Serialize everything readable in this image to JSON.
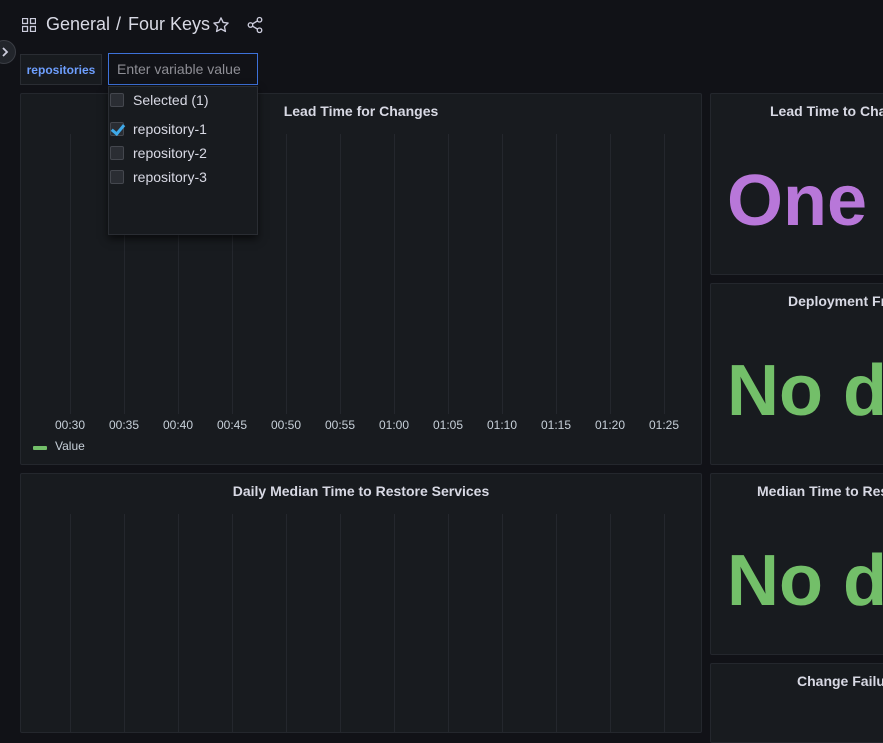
{
  "breadcrumb": {
    "folder": "General",
    "separator": "/",
    "dashboard": "Four Keys"
  },
  "icons": {
    "apps": "apps-icon",
    "star": "star-icon",
    "share": "share-icon",
    "expand": "chevron-right-icon"
  },
  "variable": {
    "label": "repositories",
    "placeholder": "Enter variable value",
    "dropdown": {
      "selected_label": "Selected (1)",
      "options": [
        {
          "label": "repository-1",
          "checked": true
        },
        {
          "label": "repository-2",
          "checked": false
        },
        {
          "label": "repository-3",
          "checked": false
        }
      ]
    }
  },
  "panels": {
    "lead_time_chart": {
      "title": "Lead Time for Changes",
      "x_ticks": [
        "00:30",
        "00:35",
        "00:40",
        "00:45",
        "00:50",
        "00:55",
        "01:00",
        "01:05",
        "01:10",
        "01:15",
        "01:20",
        "01:25"
      ],
      "legend": "Value"
    },
    "lead_time_stat": {
      "title": "Lead Time to Changes",
      "value": "One day",
      "color": "#b877d9"
    },
    "deploy_freq_stat": {
      "title": "Deployment Frequency",
      "value": "No data",
      "color": "#73bf69"
    },
    "restore_chart": {
      "title": "Daily Median Time to Restore Services"
    },
    "restore_stat": {
      "title": "Median Time to Restore Services",
      "value": "No data",
      "color": "#73bf69"
    },
    "change_failure_stat": {
      "title": "Change Failure Rate"
    }
  },
  "colors": {
    "background": "#111217",
    "panel": "#181b1f",
    "accent_blue": "#6e9fff",
    "series_green": "#73bf69"
  }
}
